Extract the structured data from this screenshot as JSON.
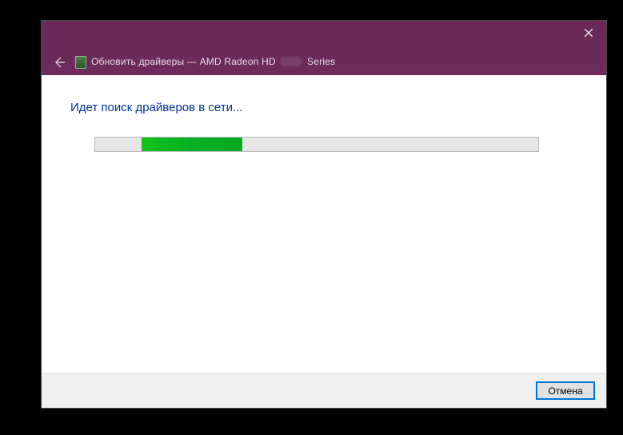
{
  "titlebar": {
    "title_prefix": "Обновить драйверы — AMD Radeon HD",
    "title_suffix": "Series"
  },
  "content": {
    "status": "Идет поиск драйверов в сети..."
  },
  "footer": {
    "cancel_label": "Отмена"
  }
}
